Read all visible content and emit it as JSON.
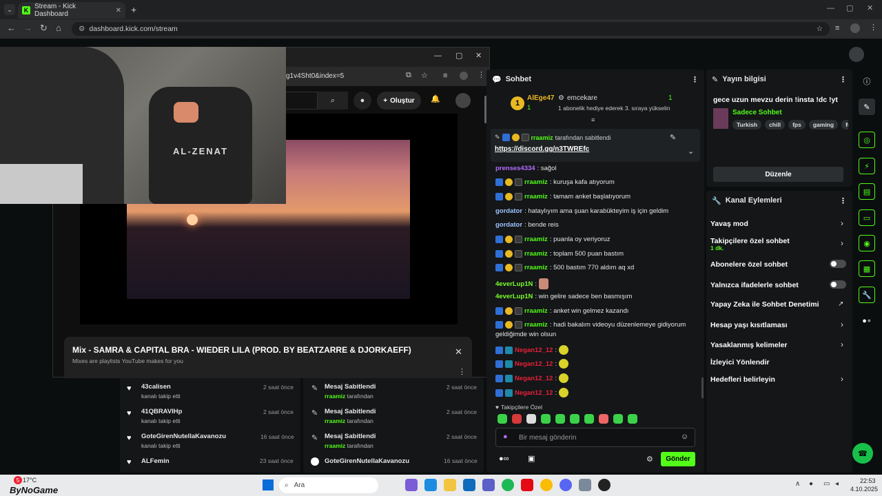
{
  "browser": {
    "tab_title": "Stream - Kick Dashboard",
    "url": "dashboard.kick.com/stream"
  },
  "popup": {
    "url_fragment": "g1v4Sht0&index=5",
    "create_label": "Oluştur",
    "mix_title": "Mix - SAMRA & CAPITAL BRA - WIEDER LILA (PROD. BY BEATZARRE & DJORKAEFF)",
    "mix_subtitle": "Mixes are playlists YouTube makes for you",
    "webcam_text": "AL-ZENAT"
  },
  "chat": {
    "title": "Sohbet",
    "leader1": {
      "rank": "1",
      "name": "AlEge47",
      "count": "1"
    },
    "leader2": {
      "name": "emcekare",
      "count": "1",
      "note": "1 abonelik hediye ederek 3. sıraya yükselin"
    },
    "pinned": {
      "pinned_by": "rraamiz",
      "pinned_suffix": "tarafından sabitlendi",
      "link": "https://discord.gg/n3TWREfc"
    },
    "messages": [
      {
        "user": "prenses4334",
        "text": ": sağol"
      },
      {
        "user": "rraamiz",
        "text": ": kuruşa kafa atıyorum"
      },
      {
        "user": "rraamiz",
        "text": ": tamam anket başlatıyorum"
      },
      {
        "user": "gordator",
        "text": ": hataylıyım ama şuan karabükteyim iş için geldim"
      },
      {
        "user": "gordator",
        "text": ": bende reis"
      },
      {
        "user": "rraamiz",
        "text": ": puanla oy veriyoruz"
      },
      {
        "user": "rraamiz",
        "text": ": toplam 500 puan bastım"
      },
      {
        "user": "rraamiz",
        "text": ": 500 bastım 770 aldım aq xd"
      },
      {
        "user": "4everLup1N",
        "text": ":"
      },
      {
        "user": "4everLup1N",
        "text": ": win gelire sadece ben basmışım"
      },
      {
        "user": "rraamiz",
        "text": ": anket win gelmez kazandı"
      },
      {
        "user": "rraamiz",
        "text": ": hadi bakalım videoyu düzenlemeye gidiyorum"
      },
      {
        "user": "",
        "text": "geldiğimde win olsun"
      },
      {
        "user": "Negan12_12",
        "text": ":"
      },
      {
        "user": "Negan12_12",
        "text": ":"
      },
      {
        "user": "Negan12_12",
        "text": ":"
      },
      {
        "user": "Negan12_12",
        "text": ":"
      }
    ],
    "followers_only": "Takipçilere Özel",
    "input_placeholder": "Bir mesaj gönderin",
    "send_label": "Gönder"
  },
  "stream_info": {
    "title": "Yayın bilgisi",
    "stream_title": "gece uzun mevzu derin !insta !dc !yt",
    "category": "Sadece Sohbet",
    "tags": [
      "Turkish",
      "chill",
      "fps",
      "gaming",
      "fu"
    ],
    "edit_label": "Düzenle"
  },
  "channel_actions": {
    "title": "Kanal Eylemleri",
    "items": [
      {
        "label": "Yavaş mod",
        "sub": ""
      },
      {
        "label": "Takipçilere özel sohbet",
        "sub": "1 dk."
      },
      {
        "label": "Abonelere özel sohbet",
        "sub": ""
      },
      {
        "label": "Yalnızca ifadelerle sohbet",
        "sub": ""
      },
      {
        "label": "Yapay Zeka ile Sohbet Denetimi",
        "sub": ""
      },
      {
        "label": "Hesap yaşı kısıtlaması",
        "sub": ""
      },
      {
        "label": "Yasaklanmış kelimeler",
        "sub": ""
      },
      {
        "label": "İzleyici Yönlendir",
        "sub": ""
      },
      {
        "label": "Hedefleri belirleyin",
        "sub": ""
      }
    ]
  },
  "activity_left": [
    {
      "name": "43calisen",
      "sub": "kanalı takip etti",
      "time": "2 saat önce"
    },
    {
      "name": "41QBRAVIHp",
      "sub": "kanalı takip etti",
      "time": "2 saat önce"
    },
    {
      "name": "GoteGirenNutellaKavanozu",
      "sub": "kanalı takip etti",
      "time": "16 saat önce"
    },
    {
      "name": "ALFemin",
      "sub": "",
      "time": "23 saat önce"
    }
  ],
  "activity_right": [
    {
      "name": "Mesaj Sabitlendi",
      "by": "rraamiz",
      "sub": "tarafından",
      "time": "2 saat önce"
    },
    {
      "name": "Mesaj Sabitlendi",
      "by": "rraamiz",
      "sub": "tarafından",
      "time": "2 saat önce"
    },
    {
      "name": "Mesaj Sabitlendi",
      "by": "rraamiz",
      "sub": "tarafından",
      "time": "2 saat önce"
    },
    {
      "name": "GoteGirenNutellaKavanozu",
      "by": "",
      "sub": "",
      "time": "16 saat önce"
    }
  ],
  "taskbar": {
    "weather": "17°C",
    "weather_badge": "5",
    "watermark": "ByNoGame",
    "search_placeholder": "Ara",
    "time": "22:53",
    "date": "4.10.2025"
  },
  "colors": {
    "kick_green": "#53fc18",
    "bg": "#0b0e0f",
    "panel": "#141618"
  }
}
